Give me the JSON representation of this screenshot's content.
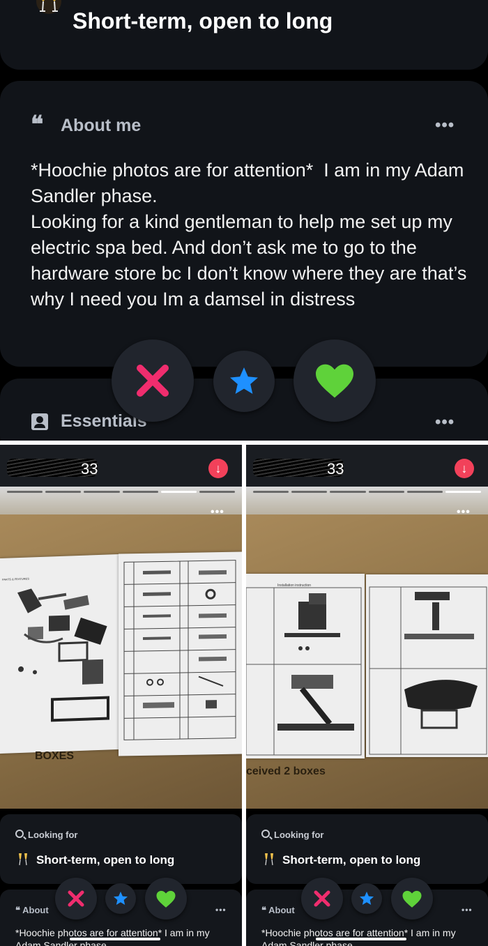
{
  "looking_for": {
    "icon": "champagne-glasses-icon",
    "title": "Short-term, open to long",
    "label": "Looking for"
  },
  "about": {
    "header": "About me",
    "header_short": "About",
    "bio": "*Hoochie photos are for attention*  I am in my Adam Sandler phase.\nLooking for a kind gentleman to help me set up my electric spa bed. And don’t ask me to go to the hardware store bc I don’t know where they are that’s why I need you Im a damsel in distress",
    "bio_line1": "*Hoochie photos are for attention*  I am in my",
    "bio_line2": "Adam Sandler phase"
  },
  "essentials": {
    "header": "Essentials"
  },
  "actions": {
    "nope": {
      "icon": "x-icon",
      "color": "#f02d6e"
    },
    "super_like": {
      "icon": "star-icon",
      "color": "#1e90ff"
    },
    "like": {
      "icon": "heart-icon",
      "color": "#4fd13b"
    }
  },
  "panels": [
    {
      "age": "33",
      "label_bottom_box": "BOXES"
    },
    {
      "age": "33",
      "label_bottom_box": "ceived 2 boxes"
    }
  ],
  "manual_text": {
    "parts_header": "PARTS & FEATURES",
    "install_header": "Installation instruction"
  },
  "more_menu": "•••"
}
